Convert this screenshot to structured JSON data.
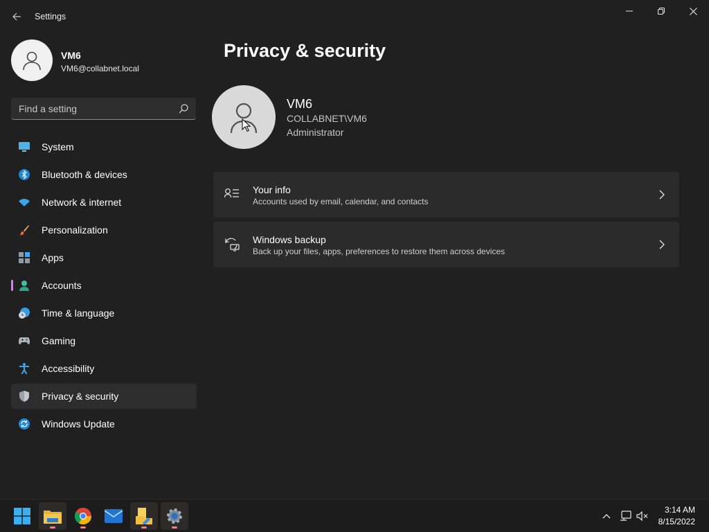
{
  "window": {
    "title": "Settings"
  },
  "profile": {
    "name": "VM6",
    "email": "VM6@collabnet.local"
  },
  "search": {
    "placeholder": "Find a setting"
  },
  "sidebar": {
    "items": [
      {
        "label": "System",
        "icon": "system-icon"
      },
      {
        "label": "Bluetooth & devices",
        "icon": "bluetooth-icon"
      },
      {
        "label": "Network & internet",
        "icon": "wifi-icon"
      },
      {
        "label": "Personalization",
        "icon": "brush-icon"
      },
      {
        "label": "Apps",
        "icon": "apps-icon"
      },
      {
        "label": "Accounts",
        "icon": "accounts-icon"
      },
      {
        "label": "Time & language",
        "icon": "clock-globe-icon"
      },
      {
        "label": "Gaming",
        "icon": "gamepad-icon"
      },
      {
        "label": "Accessibility",
        "icon": "accessibility-icon"
      },
      {
        "label": "Privacy & security",
        "icon": "shield-icon"
      },
      {
        "label": "Windows Update",
        "icon": "update-icon"
      }
    ],
    "selected": "Privacy & security"
  },
  "main": {
    "page_title": "Privacy & security",
    "user": {
      "name": "VM6",
      "domain": "COLLABNET\\VM6",
      "role": "Administrator"
    },
    "cards": [
      {
        "title": "Your info",
        "description": "Accounts used by email, calendar, and contacts",
        "icon": "user-info-icon"
      },
      {
        "title": "Windows backup",
        "description": "Back up your files, apps, preferences to restore them across devices",
        "icon": "backup-icon"
      }
    ]
  },
  "taskbar": {
    "apps": [
      {
        "name": "start",
        "icon": "windows-start-icon"
      },
      {
        "name": "file-explorer",
        "icon": "folder-icon"
      },
      {
        "name": "chrome",
        "icon": "chrome-icon"
      },
      {
        "name": "mail",
        "icon": "mail-icon"
      },
      {
        "name": "file-explorer-2",
        "icon": "folder-doc-icon"
      },
      {
        "name": "settings",
        "icon": "gear-icon"
      }
    ],
    "clock": {
      "time": "3:14 AM",
      "date": "8/15/2022"
    }
  },
  "colors": {
    "background": "#202020",
    "card": "#2b2b2b",
    "accent_indicator": "#c98bd8",
    "selected_item": "#2d2d2d"
  }
}
